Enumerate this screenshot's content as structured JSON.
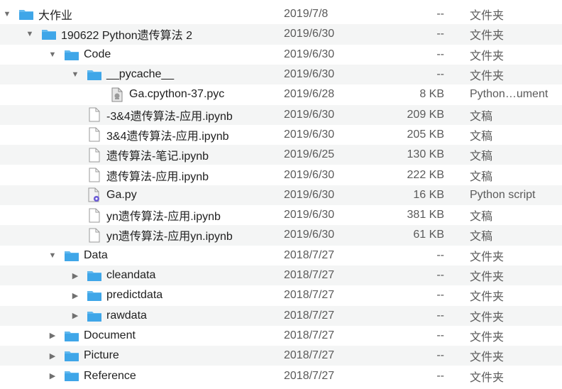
{
  "rows": [
    {
      "level": 0,
      "disclosure": "expanded",
      "icon": "folder-icon",
      "name": "大作业",
      "date": "2019/7/8",
      "size": "--",
      "kind": "文件夹"
    },
    {
      "level": 1,
      "disclosure": "expanded",
      "icon": "folder-icon",
      "name": "190622 Python遗传算法 2",
      "date": "2019/6/30",
      "size": "--",
      "kind": "文件夹"
    },
    {
      "level": 2,
      "disclosure": "expanded",
      "icon": "folder-icon",
      "name": "Code",
      "date": "2019/6/30",
      "size": "--",
      "kind": "文件夹"
    },
    {
      "level": 3,
      "disclosure": "expanded",
      "icon": "folder-icon",
      "name": "__pycache__",
      "date": "2019/6/30",
      "size": "--",
      "kind": "文件夹"
    },
    {
      "level": 4,
      "disclosure": "none",
      "icon": "pyc-file-icon",
      "name": "Ga.cpython-37.pyc",
      "date": "2019/6/28",
      "size": "8 KB",
      "kind": "Python…ument"
    },
    {
      "level": 3,
      "disclosure": "none",
      "icon": "document-icon",
      "name": "-3&4遗传算法-应用.ipynb",
      "date": "2019/6/30",
      "size": "209 KB",
      "kind": "文稿"
    },
    {
      "level": 3,
      "disclosure": "none",
      "icon": "document-icon",
      "name": "3&4遗传算法-应用.ipynb",
      "date": "2019/6/30",
      "size": "205 KB",
      "kind": "文稿"
    },
    {
      "level": 3,
      "disclosure": "none",
      "icon": "document-icon",
      "name": "遗传算法-笔记.ipynb",
      "date": "2019/6/25",
      "size": "130 KB",
      "kind": "文稿"
    },
    {
      "level": 3,
      "disclosure": "none",
      "icon": "document-icon",
      "name": "遗传算法-应用.ipynb",
      "date": "2019/6/30",
      "size": "222 KB",
      "kind": "文稿"
    },
    {
      "level": 3,
      "disclosure": "none",
      "icon": "python-script-icon",
      "name": "Ga.py",
      "date": "2019/6/30",
      "size": "16 KB",
      "kind": "Python script"
    },
    {
      "level": 3,
      "disclosure": "none",
      "icon": "document-icon",
      "name": "yn遗传算法-应用.ipynb",
      "date": "2019/6/30",
      "size": "381 KB",
      "kind": "文稿"
    },
    {
      "level": 3,
      "disclosure": "none",
      "icon": "document-icon",
      "name": "yn遗传算法-应用yn.ipynb",
      "date": "2019/6/30",
      "size": "61 KB",
      "kind": "文稿"
    },
    {
      "level": 2,
      "disclosure": "expanded",
      "icon": "folder-icon",
      "name": "Data",
      "date": "2018/7/27",
      "size": "--",
      "kind": "文件夹"
    },
    {
      "level": 3,
      "disclosure": "collapsed",
      "icon": "folder-icon",
      "name": "cleandata",
      "date": "2018/7/27",
      "size": "--",
      "kind": "文件夹"
    },
    {
      "level": 3,
      "disclosure": "collapsed",
      "icon": "folder-icon",
      "name": "predictdata",
      "date": "2018/7/27",
      "size": "--",
      "kind": "文件夹"
    },
    {
      "level": 3,
      "disclosure": "collapsed",
      "icon": "folder-icon",
      "name": "rawdata",
      "date": "2018/7/27",
      "size": "--",
      "kind": "文件夹"
    },
    {
      "level": 2,
      "disclosure": "collapsed",
      "icon": "folder-icon",
      "name": "Document",
      "date": "2018/7/27",
      "size": "--",
      "kind": "文件夹"
    },
    {
      "level": 2,
      "disclosure": "collapsed",
      "icon": "folder-icon",
      "name": "Picture",
      "date": "2018/7/27",
      "size": "--",
      "kind": "文件夹"
    },
    {
      "level": 2,
      "disclosure": "collapsed",
      "icon": "folder-icon",
      "name": "Reference",
      "date": "2018/7/27",
      "size": "--",
      "kind": "文件夹"
    }
  ],
  "colors": {
    "folder": "#3fa6e8",
    "folder_tab": "#62b9ef",
    "row_alt": "#f4f5f5",
    "text_primary": "#1f1f1f",
    "text_secondary": "#5a5a5a"
  }
}
